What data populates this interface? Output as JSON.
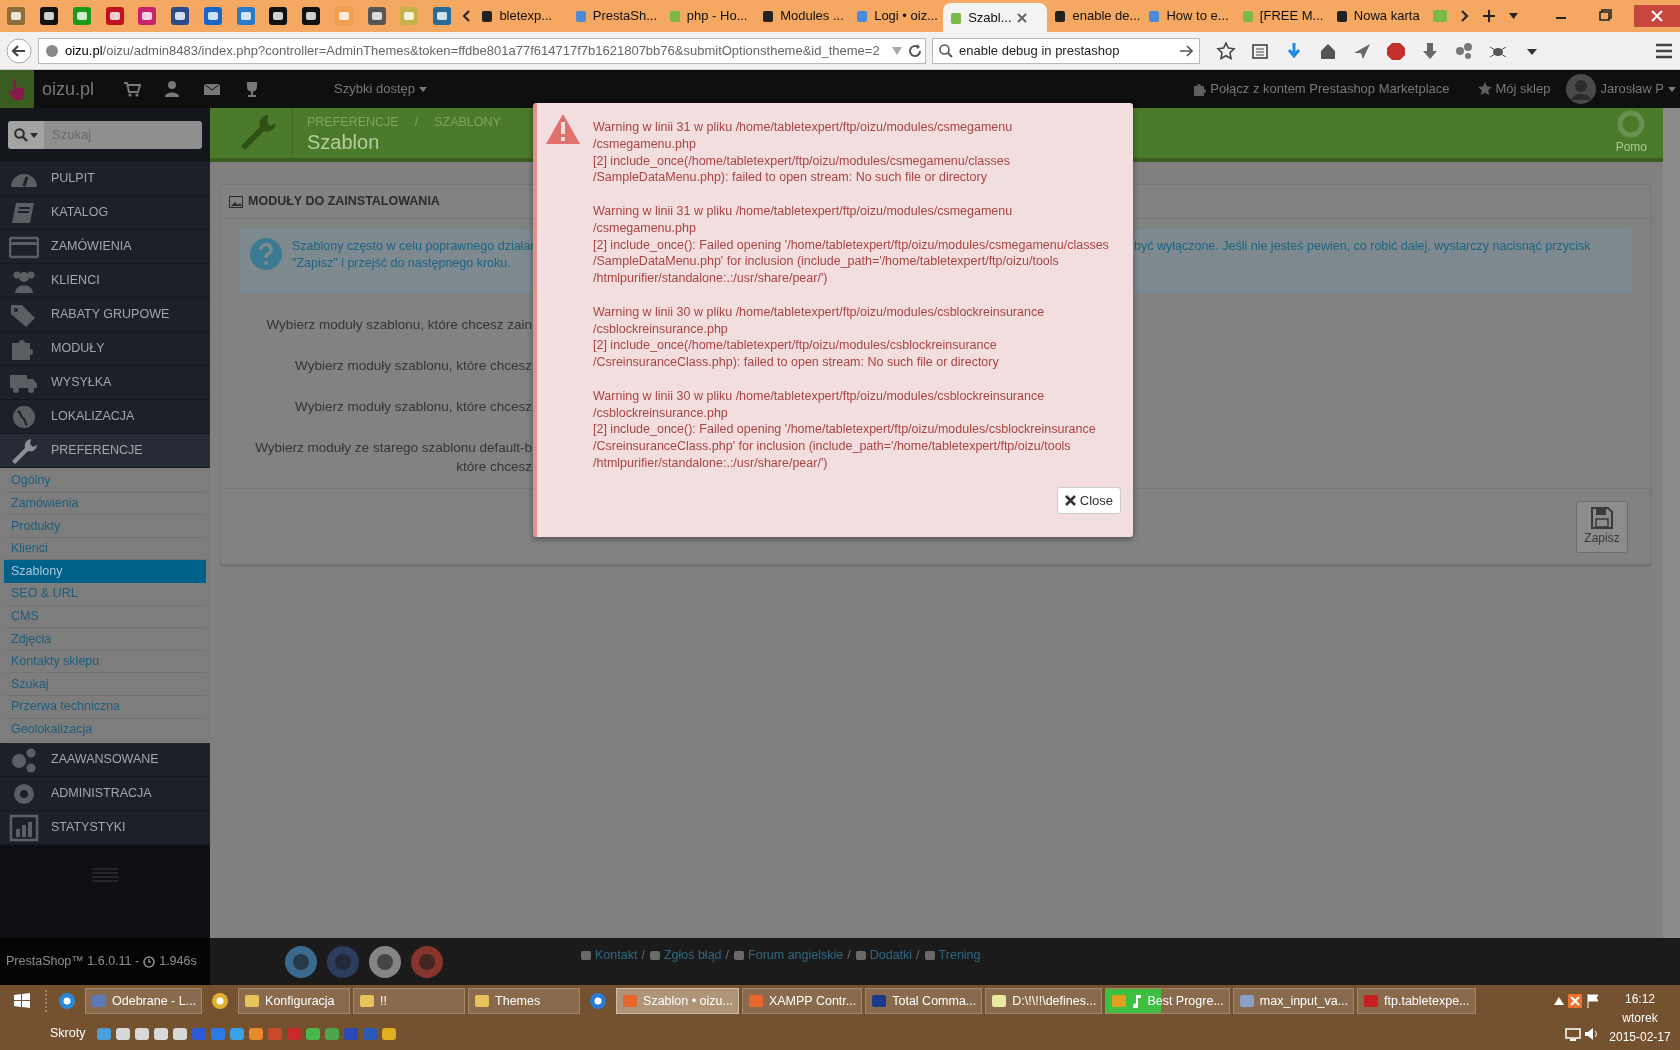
{
  "browser": {
    "tabs": [
      {
        "label": "bletexp...",
        "selected": false
      },
      {
        "label": "PrestaSh...",
        "selected": false
      },
      {
        "label": "php - Ho...",
        "selected": false
      },
      {
        "label": "Modules ...",
        "selected": false
      },
      {
        "label": "Logi • oiz...",
        "selected": false
      },
      {
        "label": "Szabl...",
        "selected": true
      },
      {
        "label": "enable de...",
        "selected": false
      },
      {
        "label": "How to e...",
        "selected": false
      },
      {
        "label": "[FREE M...",
        "selected": false
      },
      {
        "label": "Nowa karta",
        "selected": false
      }
    ],
    "address_host": "oizu.pl",
    "address_path": "/oizu/admin8483/index.php?controller=AdminThemes&token=ffdbe801a77f614717f7b1621807bb76&submitOptionstheme&id_theme=2",
    "search": "enable debug in prestashop"
  },
  "admin_header": {
    "site": "oizu.pl",
    "quick_access": "Szybki dostęp",
    "marketplace": "Połącz z kontem Prestashop Marketplace",
    "my_shop": "Mój sklep",
    "user": "Jarosław P"
  },
  "sidebar": {
    "search_placeholder": "Szukaj",
    "items": [
      {
        "label": "PULPIT",
        "selected": false
      },
      {
        "label": "KATALOG",
        "selected": false
      },
      {
        "label": "ZAMÓWIENIA",
        "selected": false
      },
      {
        "label": "KLIENCI",
        "selected": false
      },
      {
        "label": "RABATY GRUPOWE",
        "selected": false
      },
      {
        "label": "MODUŁY",
        "selected": false
      },
      {
        "label": "WYSYŁKA",
        "selected": false
      },
      {
        "label": "LOKALIZACJA",
        "selected": false
      },
      {
        "label": "PREFERENCJE",
        "selected": true,
        "expanded": true,
        "children": [
          {
            "label": "Ogólny",
            "selected": false
          },
          {
            "label": "Zamówienia",
            "selected": false
          },
          {
            "label": "Produkty",
            "selected": false
          },
          {
            "label": "Klienci",
            "selected": false
          },
          {
            "label": "Szablony",
            "selected": true
          },
          {
            "label": "SEO & URL",
            "selected": false
          },
          {
            "label": "CMS",
            "selected": false
          },
          {
            "label": "Zdjęcia",
            "selected": false
          },
          {
            "label": "Kontakty sklepu",
            "selected": false
          },
          {
            "label": "Szukaj",
            "selected": false
          },
          {
            "label": "Przerwa techniczna",
            "selected": false
          },
          {
            "label": "Geolokalizacja",
            "selected": false
          }
        ]
      },
      {
        "label": "ZAAWANSOWANE",
        "selected": false
      },
      {
        "label": "ADMINISTRACJA",
        "selected": false
      },
      {
        "label": "STATYSTYKI",
        "selected": false
      }
    ]
  },
  "page_header": {
    "breadcrumb": [
      "PREFERENCJE",
      "SZABLONY"
    ],
    "separator": "/",
    "title": "Szablon",
    "help": "Pomo"
  },
  "panel": {
    "title": "MODUŁY DO ZAINSTALOWANIA",
    "alert_left": [
      "Szablony często w celu poprawnego działar",
      "\"Zapisz\" i przejść do następnego kroku."
    ],
    "alert_right": "być wyłączone. Jeśli nie jesteś pewien, co robić dalej, wystarczy nacisnąć przycisk",
    "fields": [
      "Wybierz moduły szablonu, które chcesz zain",
      "Wybierz moduły szablonu, które chcesz",
      "Wybierz moduły szablonu, które chcesz",
      "Wybierz moduły ze starego szablonu default-b\nktóre chcesz"
    ],
    "save": "Zapisz"
  },
  "modal": {
    "warnings": [
      "Warning w linii 31 w pliku /home/tabletexpert/ftp/oizu/modules/csmegamenu\n/csmegamenu.php\n[2] include_once(/home/tabletexpert/ftp/oizu/modules/csmegamenu/classes\n/SampleDataMenu.php): failed to open stream: No such file or directory",
      "Warning w linii 31 w pliku /home/tabletexpert/ftp/oizu/modules/csmegamenu\n/csmegamenu.php\n[2] include_once(): Failed opening '/home/tabletexpert/ftp/oizu/modules/csmegamenu/classes\n/SampleDataMenu.php' for inclusion (include_path='/home/tabletexpert/ftp/oizu/tools\n/htmlpurifier/standalone:.:/usr/share/pear/')",
      "Warning w linii 30 w pliku /home/tabletexpert/ftp/oizu/modules/csblockreinsurance\n/csblockreinsurance.php\n[2] include_once(/home/tabletexpert/ftp/oizu/modules/csblockreinsurance\n/CsreinsuranceClass.php): failed to open stream: No such file or directory",
      "Warning w linii 30 w pliku /home/tabletexpert/ftp/oizu/modules/csblockreinsurance\n/csblockreinsurance.php\n[2] include_once(): Failed opening '/home/tabletexpert/ftp/oizu/modules/csblockreinsurance\n/CsreinsuranceClass.php' for inclusion (include_path='/home/tabletexpert/ftp/oizu/tools\n/htmlpurifier/standalone:.:/usr/share/pear/')"
    ],
    "close": "Close"
  },
  "footer": {
    "version": "PrestaShop™ 1.6.0.11 -",
    "time": "1.946s",
    "links": [
      "Kontakt",
      "Zgłoś błąd",
      "Forum angielskie",
      "Dodatki",
      "Trening"
    ],
    "separator": "/"
  },
  "taskbar": {
    "items": [
      {
        "kind": "pinned"
      },
      {
        "kind": "window",
        "label": "Odebrane - L...",
        "selected": false
      },
      {
        "kind": "pinned"
      },
      {
        "kind": "window",
        "label": "Konfiguracja",
        "selected": false
      },
      {
        "kind": "window",
        "label": "!!",
        "selected": false
      },
      {
        "kind": "window",
        "label": "Themes",
        "selected": false
      },
      {
        "kind": "pinned"
      },
      {
        "kind": "window",
        "label": "Szablon • oizu...",
        "selected": true
      },
      {
        "kind": "window",
        "label": "XAMPP Contr...",
        "selected": false
      },
      {
        "kind": "window",
        "label": "Total Comma...",
        "selected": false
      },
      {
        "kind": "window",
        "label": "D:\\!\\!!\\defines...",
        "selected": false
      },
      {
        "kind": "progress",
        "label": "Best Progre...",
        "selected": false,
        "level": 0.45
      },
      {
        "kind": "window",
        "label": "max_input_va...",
        "selected": false
      },
      {
        "kind": "window",
        "label": "ftp.tabletexpe...",
        "selected": false
      }
    ],
    "toolbar_label": "Skroty",
    "time": "16:12",
    "day": "wtorek",
    "date": "2015-02-17"
  }
}
